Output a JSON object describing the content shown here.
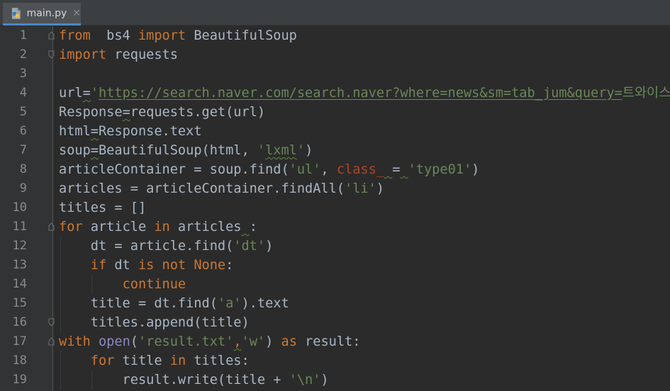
{
  "tab": {
    "filename": "main.py",
    "close_glyph": "✕",
    "icon": "python-file-icon"
  },
  "lines": [
    {
      "n": "1",
      "segments": [
        [
          "kw",
          "from"
        ],
        [
          "",
          "  bs4 "
        ],
        [
          "kw",
          "import"
        ],
        [
          "",
          " BeautifulSoup"
        ]
      ]
    },
    {
      "n": "2",
      "segments": [
        [
          "kw",
          "import"
        ],
        [
          "",
          " requests"
        ]
      ]
    },
    {
      "n": "3",
      "segments": []
    },
    {
      "n": "4",
      "segments": [
        [
          "",
          "url"
        ],
        [
          "wavy",
          "="
        ],
        [
          "str",
          "'"
        ],
        [
          "url",
          "https://search.naver.com/search.naver?where=news&sm=tab_jum&query="
        ],
        [
          "str",
          "트와이스'"
        ]
      ]
    },
    {
      "n": "5",
      "segments": [
        [
          "",
          "Response"
        ],
        [
          "wavy",
          "="
        ],
        [
          "",
          "requests.get(url)"
        ]
      ]
    },
    {
      "n": "6",
      "segments": [
        [
          "",
          "html"
        ],
        [
          "wavy",
          "="
        ],
        [
          "",
          "Response.text"
        ]
      ]
    },
    {
      "n": "7",
      "segments": [
        [
          "",
          "soup"
        ],
        [
          "wavy",
          "="
        ],
        [
          "",
          "BeautifulSoup(html, "
        ],
        [
          "str",
          "'"
        ],
        [
          "strwavy",
          "lxml"
        ],
        [
          "str",
          "'"
        ],
        [
          "",
          ")"
        ]
      ]
    },
    {
      "n": "8",
      "segments": [
        [
          "",
          "articleContainer = soup.find("
        ],
        [
          "str",
          "'ul'"
        ],
        [
          "",
          ", "
        ],
        [
          "nm",
          "class_"
        ],
        [
          "wavy",
          " "
        ],
        [
          "",
          "="
        ],
        [
          "wavy",
          " "
        ],
        [
          "str",
          "'type01'"
        ],
        [
          "",
          ")"
        ]
      ]
    },
    {
      "n": "9",
      "segments": [
        [
          "",
          "articles = articleContainer.findAll("
        ],
        [
          "str",
          "'li'"
        ],
        [
          "",
          ")"
        ]
      ]
    },
    {
      "n": "10",
      "segments": [
        [
          "",
          "titles = []"
        ]
      ]
    },
    {
      "n": "11",
      "segments": [
        [
          "kw",
          "for"
        ],
        [
          "",
          " article "
        ],
        [
          "kw",
          "in"
        ],
        [
          "",
          " articles"
        ],
        [
          "wavy",
          " "
        ],
        [
          "",
          ":"
        ]
      ]
    },
    {
      "n": "12",
      "segments": [
        [
          "",
          "    dt = article.find("
        ],
        [
          "str",
          "'dt'"
        ],
        [
          "",
          ")"
        ]
      ]
    },
    {
      "n": "13",
      "segments": [
        [
          "",
          "    "
        ],
        [
          "kw",
          "if"
        ],
        [
          "",
          " dt "
        ],
        [
          "kw",
          "is not None"
        ],
        [
          "",
          ":"
        ]
      ]
    },
    {
      "n": "14",
      "segments": [
        [
          "",
          "        "
        ],
        [
          "kw",
          "continue"
        ]
      ]
    },
    {
      "n": "15",
      "segments": [
        [
          "",
          "    title = dt.find("
        ],
        [
          "str",
          "'a'"
        ],
        [
          "",
          ").text"
        ]
      ]
    },
    {
      "n": "16",
      "segments": [
        [
          "",
          "    titles.append(title)"
        ]
      ]
    },
    {
      "n": "17",
      "segments": [
        [
          "kw",
          "with"
        ],
        [
          "",
          " "
        ],
        [
          "bi",
          "open"
        ],
        [
          "",
          "("
        ],
        [
          "str",
          "'result.txt'"
        ],
        [
          "kwwavy",
          ","
        ],
        [
          "str",
          "'w'"
        ],
        [
          "",
          ") "
        ],
        [
          "kw",
          "as"
        ],
        [
          "",
          " result:"
        ]
      ]
    },
    {
      "n": "18",
      "segments": [
        [
          "",
          "    "
        ],
        [
          "kw",
          "for"
        ],
        [
          "",
          " title "
        ],
        [
          "kw",
          "in"
        ],
        [
          "",
          " titles:"
        ]
      ]
    },
    {
      "n": "19",
      "segments": [
        [
          "",
          "        result.write(title + "
        ],
        [
          "str",
          "'\\n'"
        ],
        [
          "",
          ")"
        ]
      ]
    }
  ],
  "fold_lines": [
    "1",
    "2",
    "11",
    "16",
    "17"
  ],
  "colors": {
    "background": "#2b2b2b",
    "keyword": "#cc7832",
    "string": "#6a8759",
    "default": "#a9b7c6",
    "named_arg": "#aa4926",
    "builtin": "#8888c6",
    "line_number": "#8b8b8b"
  }
}
